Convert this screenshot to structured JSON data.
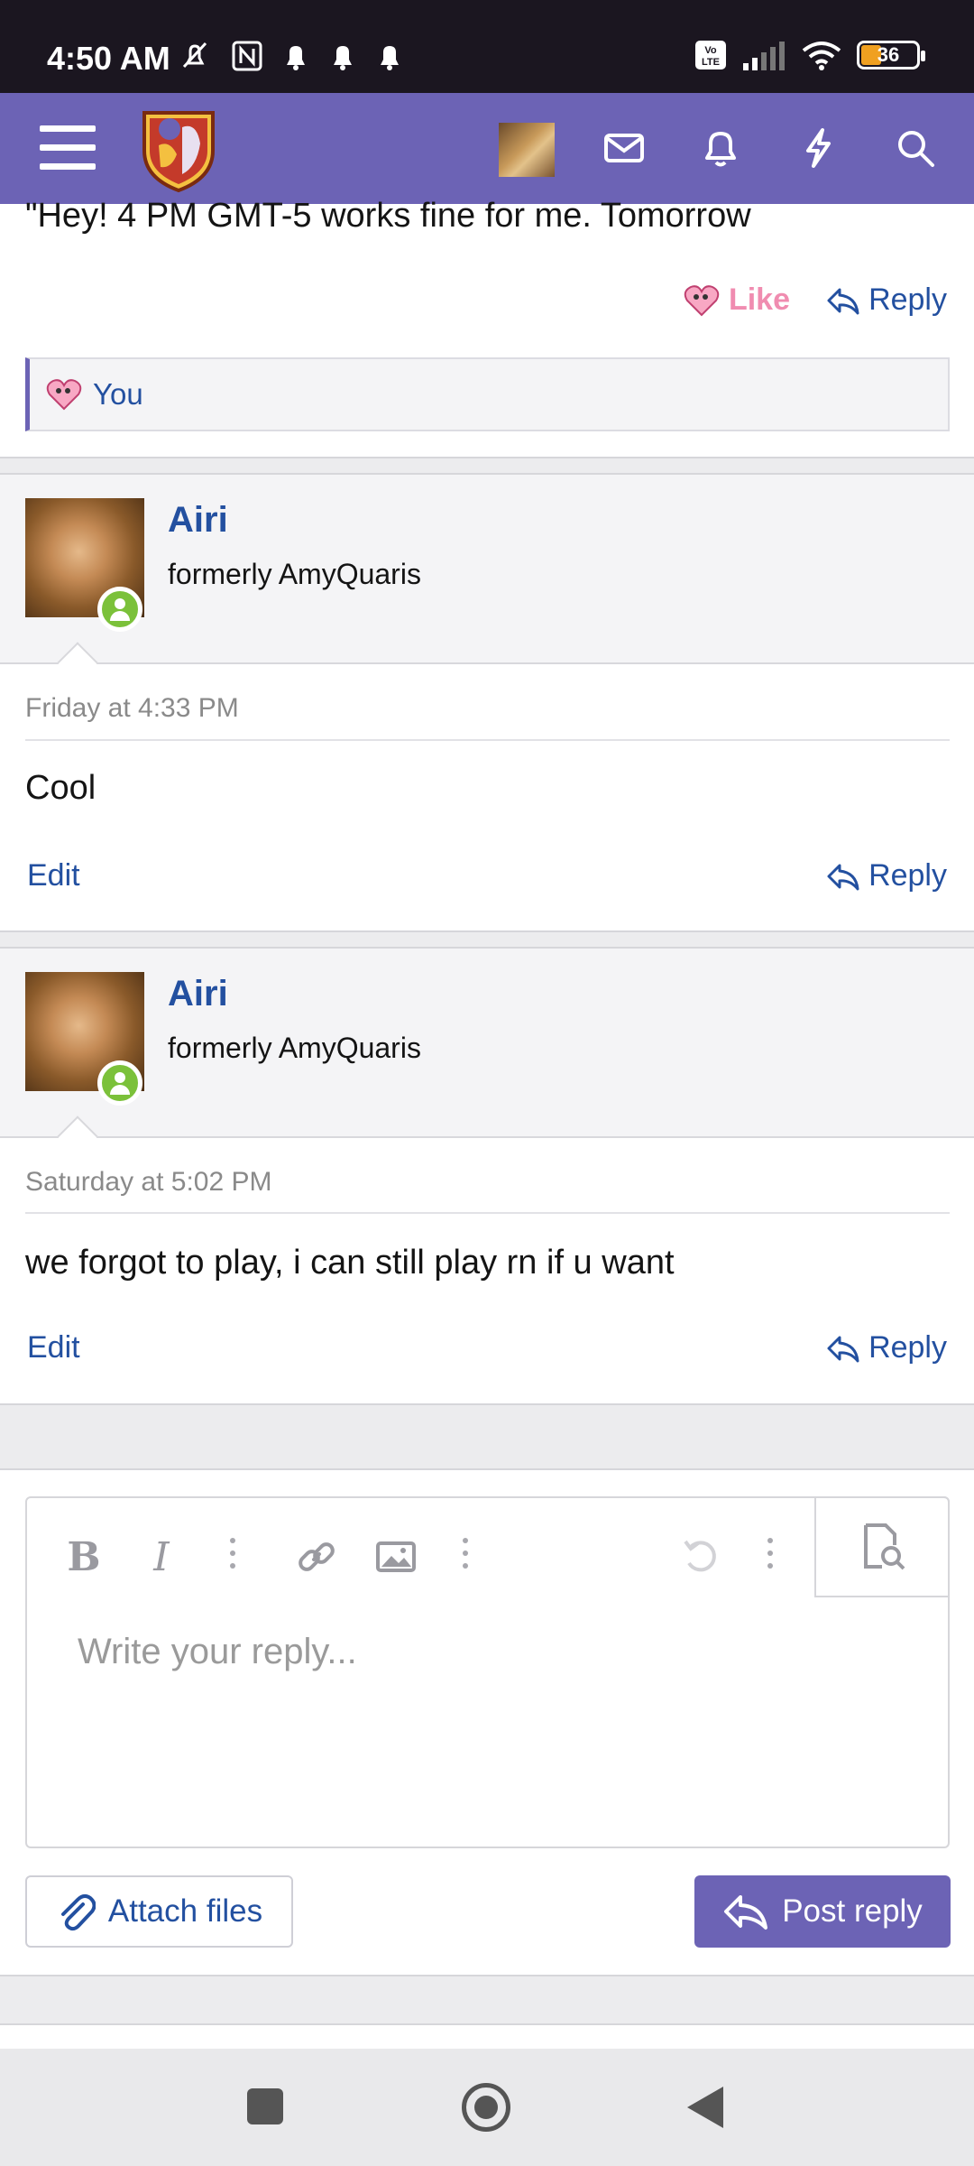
{
  "status_bar": {
    "time": "4:50 AM",
    "battery": "36",
    "network": "LTE"
  },
  "header": {
    "menu_icon": "hamburger-icon",
    "logo_icon": "site-logo",
    "icons": [
      "mail-icon",
      "bell-icon",
      "lightning-icon",
      "search-icon"
    ],
    "accent_color": "#6c63b5"
  },
  "quoted_post": {
    "text": "\"Hey! 4 PM GMT-5 works fine for me. Tomorrow",
    "like_label": "Like",
    "reply_label": "Reply",
    "likes_by": "You"
  },
  "posts": [
    {
      "username": "Airi",
      "user_title": "formerly AmyQuaris",
      "date": "Friday at 4:33 PM",
      "body": "Cool",
      "edit_label": "Edit",
      "reply_label": "Reply"
    },
    {
      "username": "Airi",
      "user_title": "formerly AmyQuaris",
      "date": "Saturday at 5:02 PM",
      "body": "we forgot to play, i can still play rn if u want",
      "edit_label": "Edit",
      "reply_label": "Reply"
    }
  ],
  "editor": {
    "placeholder": "Write your reply...",
    "toolbar": [
      "bold-icon",
      "italic-icon",
      "more-icon",
      "link-icon",
      "image-icon",
      "more-icon",
      "undo-icon",
      "more-icon",
      "preview-icon"
    ]
  },
  "buttons": {
    "attach": "Attach files",
    "post_reply": "Post reply"
  }
}
